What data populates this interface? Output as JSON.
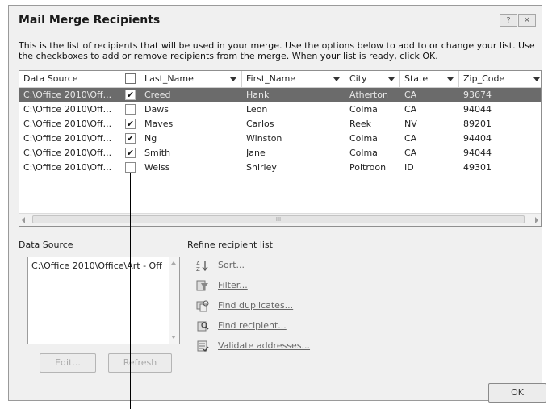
{
  "window": {
    "title": "Mail Merge Recipients",
    "help_glyph": "?",
    "close_glyph": "✕"
  },
  "intro_text": "This is the list of recipients that will be used in your merge.  Use the options below to add to or change your list.  Use the checkboxes to add or remove recipients from the merge.  When your list is ready, click OK.",
  "table": {
    "headers": {
      "data_source": "Data Source",
      "last_name": "Last_Name",
      "first_name": "First_Name",
      "city": "City",
      "state": "State",
      "zip": "Zip_Code"
    },
    "rows": [
      {
        "source": "C:\\Office 2010\\Off...",
        "checked": "✔",
        "last": "Creed",
        "first": "Hank",
        "city": "Atherton",
        "state": "CA",
        "zip": "93674"
      },
      {
        "source": "C:\\Office 2010\\Off...",
        "checked": "",
        "last": "Daws",
        "first": "Leon",
        "city": "Colma",
        "state": "CA",
        "zip": "94044"
      },
      {
        "source": "C:\\Office 2010\\Off...",
        "checked": "✔",
        "last": "Maves",
        "first": "Carlos",
        "city": "Reek",
        "state": "NV",
        "zip": "89201"
      },
      {
        "source": "C:\\Office 2010\\Off...",
        "checked": "✔",
        "last": "Ng",
        "first": "Winston",
        "city": "Colma",
        "state": "CA",
        "zip": "94404"
      },
      {
        "source": "C:\\Office 2010\\Off...",
        "checked": "✔",
        "last": "Smith",
        "first": "Jane",
        "city": "Colma",
        "state": "CA",
        "zip": "94044"
      },
      {
        "source": "C:\\Office 2010\\Off...",
        "checked": "",
        "last": "Weiss",
        "first": "Shirley",
        "city": "Poltroon",
        "state": "ID",
        "zip": "49301"
      }
    ],
    "scroll_thumb_glyph": "III"
  },
  "data_source": {
    "label": "Data Source",
    "items": [
      "C:\\Office 2010\\Office\\Art - Off"
    ],
    "edit_label": "Edit...",
    "refresh_label": "Refresh"
  },
  "refine": {
    "label": "Refine recipient list",
    "sort": "Sort...",
    "filter": "Filter...",
    "find_duplicates": "Find duplicates...",
    "find_recipient": "Find recipient...",
    "validate": "Validate addresses..."
  },
  "ok_label": "OK",
  "colors": {
    "selected_row": "#6b6b6b",
    "dialog_bg": "#f0f0f0"
  }
}
